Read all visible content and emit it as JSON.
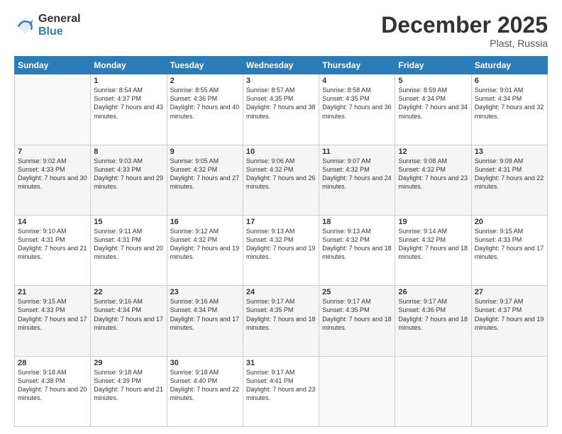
{
  "header": {
    "logo_general": "General",
    "logo_blue": "Blue",
    "month_title": "December 2025",
    "location": "Plast, Russia"
  },
  "weekdays": [
    "Sunday",
    "Monday",
    "Tuesday",
    "Wednesday",
    "Thursday",
    "Friday",
    "Saturday"
  ],
  "weeks": [
    [
      {
        "day": "",
        "sunrise": "",
        "sunset": "",
        "daylight": ""
      },
      {
        "day": "1",
        "sunrise": "Sunrise: 8:54 AM",
        "sunset": "Sunset: 4:37 PM",
        "daylight": "Daylight: 7 hours and 43 minutes."
      },
      {
        "day": "2",
        "sunrise": "Sunrise: 8:55 AM",
        "sunset": "Sunset: 4:36 PM",
        "daylight": "Daylight: 7 hours and 40 minutes."
      },
      {
        "day": "3",
        "sunrise": "Sunrise: 8:57 AM",
        "sunset": "Sunset: 4:35 PM",
        "daylight": "Daylight: 7 hours and 38 minutes."
      },
      {
        "day": "4",
        "sunrise": "Sunrise: 8:58 AM",
        "sunset": "Sunset: 4:35 PM",
        "daylight": "Daylight: 7 hours and 36 minutes."
      },
      {
        "day": "5",
        "sunrise": "Sunrise: 8:59 AM",
        "sunset": "Sunset: 4:34 PM",
        "daylight": "Daylight: 7 hours and 34 minutes."
      },
      {
        "day": "6",
        "sunrise": "Sunrise: 9:01 AM",
        "sunset": "Sunset: 4:34 PM",
        "daylight": "Daylight: 7 hours and 32 minutes."
      }
    ],
    [
      {
        "day": "7",
        "sunrise": "Sunrise: 9:02 AM",
        "sunset": "Sunset: 4:33 PM",
        "daylight": "Daylight: 7 hours and 30 minutes."
      },
      {
        "day": "8",
        "sunrise": "Sunrise: 9:03 AM",
        "sunset": "Sunset: 4:33 PM",
        "daylight": "Daylight: 7 hours and 29 minutes."
      },
      {
        "day": "9",
        "sunrise": "Sunrise: 9:05 AM",
        "sunset": "Sunset: 4:32 PM",
        "daylight": "Daylight: 7 hours and 27 minutes."
      },
      {
        "day": "10",
        "sunrise": "Sunrise: 9:06 AM",
        "sunset": "Sunset: 4:32 PM",
        "daylight": "Daylight: 7 hours and 26 minutes."
      },
      {
        "day": "11",
        "sunrise": "Sunrise: 9:07 AM",
        "sunset": "Sunset: 4:32 PM",
        "daylight": "Daylight: 7 hours and 24 minutes."
      },
      {
        "day": "12",
        "sunrise": "Sunrise: 9:08 AM",
        "sunset": "Sunset: 4:32 PM",
        "daylight": "Daylight: 7 hours and 23 minutes."
      },
      {
        "day": "13",
        "sunrise": "Sunrise: 9:09 AM",
        "sunset": "Sunset: 4:31 PM",
        "daylight": "Daylight: 7 hours and 22 minutes."
      }
    ],
    [
      {
        "day": "14",
        "sunrise": "Sunrise: 9:10 AM",
        "sunset": "Sunset: 4:31 PM",
        "daylight": "Daylight: 7 hours and 21 minutes."
      },
      {
        "day": "15",
        "sunrise": "Sunrise: 9:11 AM",
        "sunset": "Sunset: 4:31 PM",
        "daylight": "Daylight: 7 hours and 20 minutes."
      },
      {
        "day": "16",
        "sunrise": "Sunrise: 9:12 AM",
        "sunset": "Sunset: 4:32 PM",
        "daylight": "Daylight: 7 hours and 19 minutes."
      },
      {
        "day": "17",
        "sunrise": "Sunrise: 9:13 AM",
        "sunset": "Sunset: 4:32 PM",
        "daylight": "Daylight: 7 hours and 19 minutes."
      },
      {
        "day": "18",
        "sunrise": "Sunrise: 9:13 AM",
        "sunset": "Sunset: 4:32 PM",
        "daylight": "Daylight: 7 hours and 18 minutes."
      },
      {
        "day": "19",
        "sunrise": "Sunrise: 9:14 AM",
        "sunset": "Sunset: 4:32 PM",
        "daylight": "Daylight: 7 hours and 18 minutes."
      },
      {
        "day": "20",
        "sunrise": "Sunrise: 9:15 AM",
        "sunset": "Sunset: 4:33 PM",
        "daylight": "Daylight: 7 hours and 17 minutes."
      }
    ],
    [
      {
        "day": "21",
        "sunrise": "Sunrise: 9:15 AM",
        "sunset": "Sunset: 4:33 PM",
        "daylight": "Daylight: 7 hours and 17 minutes."
      },
      {
        "day": "22",
        "sunrise": "Sunrise: 9:16 AM",
        "sunset": "Sunset: 4:34 PM",
        "daylight": "Daylight: 7 hours and 17 minutes."
      },
      {
        "day": "23",
        "sunrise": "Sunrise: 9:16 AM",
        "sunset": "Sunset: 4:34 PM",
        "daylight": "Daylight: 7 hours and 17 minutes."
      },
      {
        "day": "24",
        "sunrise": "Sunrise: 9:17 AM",
        "sunset": "Sunset: 4:35 PM",
        "daylight": "Daylight: 7 hours and 18 minutes."
      },
      {
        "day": "25",
        "sunrise": "Sunrise: 9:17 AM",
        "sunset": "Sunset: 4:35 PM",
        "daylight": "Daylight: 7 hours and 18 minutes."
      },
      {
        "day": "26",
        "sunrise": "Sunrise: 9:17 AM",
        "sunset": "Sunset: 4:36 PM",
        "daylight": "Daylight: 7 hours and 18 minutes."
      },
      {
        "day": "27",
        "sunrise": "Sunrise: 9:17 AM",
        "sunset": "Sunset: 4:37 PM",
        "daylight": "Daylight: 7 hours and 19 minutes."
      }
    ],
    [
      {
        "day": "28",
        "sunrise": "Sunrise: 9:18 AM",
        "sunset": "Sunset: 4:38 PM",
        "daylight": "Daylight: 7 hours and 20 minutes."
      },
      {
        "day": "29",
        "sunrise": "Sunrise: 9:18 AM",
        "sunset": "Sunset: 4:39 PM",
        "daylight": "Daylight: 7 hours and 21 minutes."
      },
      {
        "day": "30",
        "sunrise": "Sunrise: 9:18 AM",
        "sunset": "Sunset: 4:40 PM",
        "daylight": "Daylight: 7 hours and 22 minutes."
      },
      {
        "day": "31",
        "sunrise": "Sunrise: 9:17 AM",
        "sunset": "Sunset: 4:41 PM",
        "daylight": "Daylight: 7 hours and 23 minutes."
      },
      {
        "day": "",
        "sunrise": "",
        "sunset": "",
        "daylight": ""
      },
      {
        "day": "",
        "sunrise": "",
        "sunset": "",
        "daylight": ""
      },
      {
        "day": "",
        "sunrise": "",
        "sunset": "",
        "daylight": ""
      }
    ]
  ]
}
